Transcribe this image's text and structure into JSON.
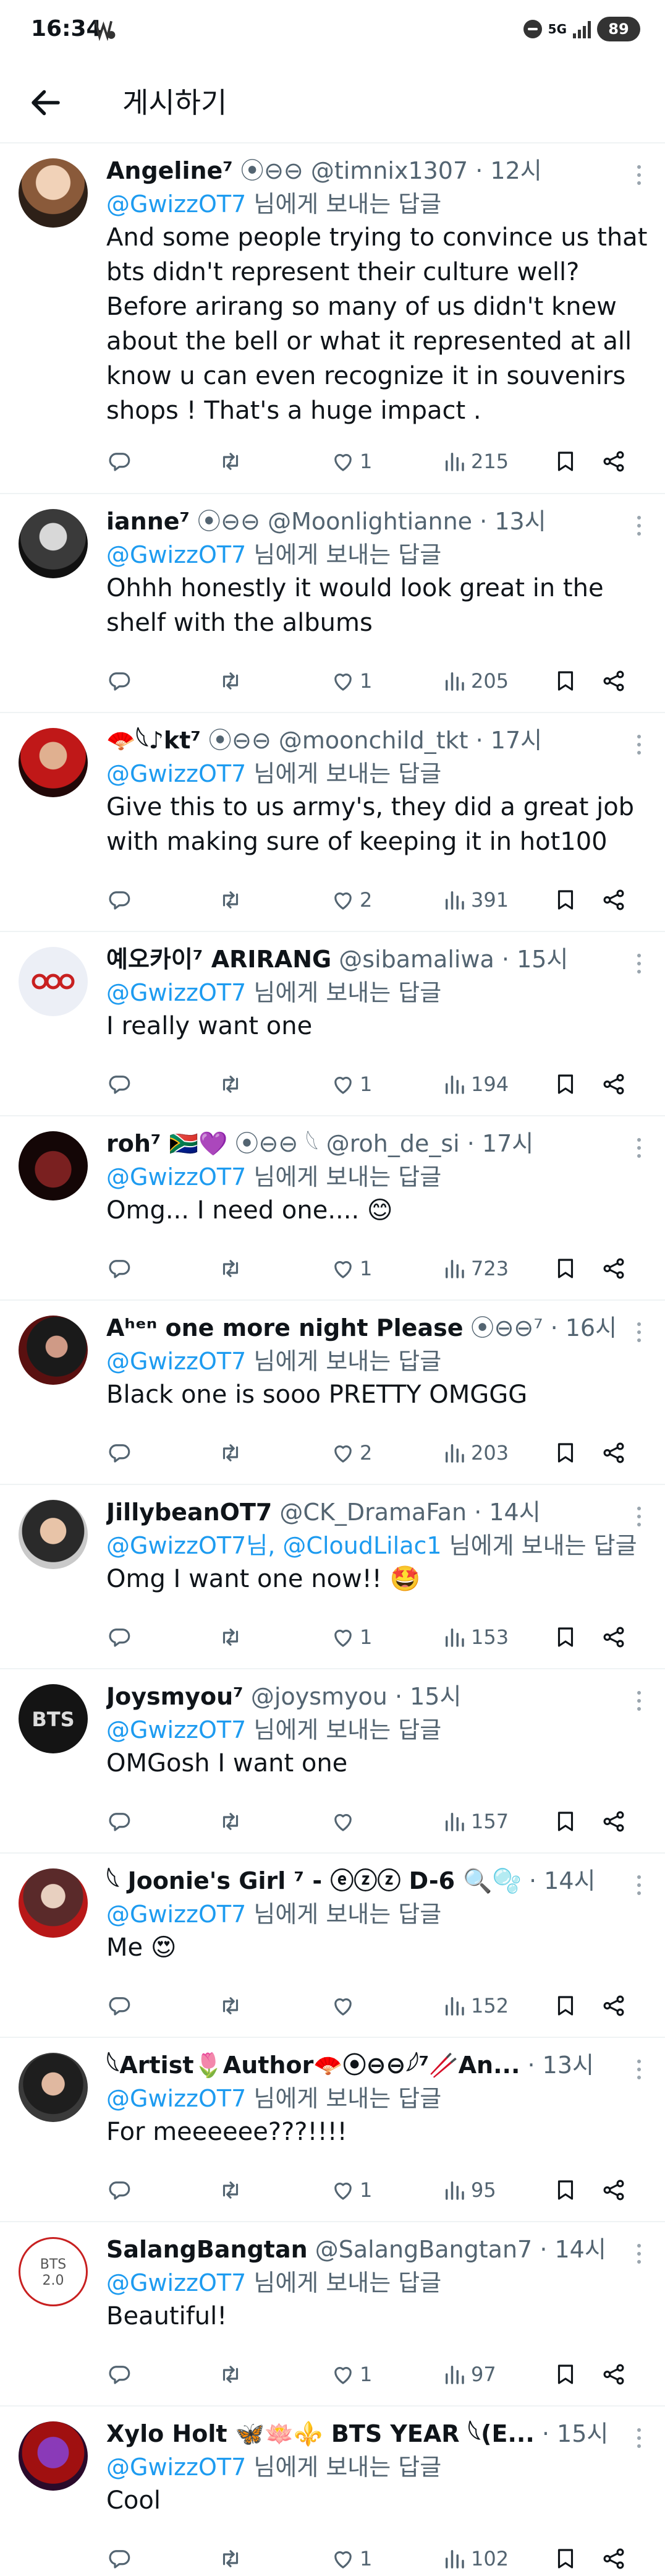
{
  "status_bar": {
    "time": "16:34",
    "network": "5G",
    "battery": "89"
  },
  "header": {
    "title": "게시하기"
  },
  "replying_suffix": "님에게 보내는 답글",
  "colors": {
    "link": "#1d9bf0",
    "secondary": "#536471",
    "divider": "#eff3f4"
  },
  "posts": [
    {
      "name": "Angeline⁷",
      "badges": "⦿⊖⊖",
      "handle": "@timnix1307",
      "time": "· 12시",
      "reply_to": "@GwizzOT7",
      "reply_to_2": "",
      "text": "And some people trying to convince us that bts didn't represent their culture well? Before arirang so many of us didn't knew about the bell or what it represented at all know u can even recognize it in souvenirs shops ! That's a huge impact  .",
      "likes": "1",
      "views": "215"
    },
    {
      "name": "ianne⁷",
      "badges": "⦿⊖⊖",
      "handle": "@Moonlightianne",
      "time": "· 13시",
      "reply_to": "@GwizzOT7",
      "reply_to_2": "",
      "text": "Ohhh honestly it would look great in the shelf with the albums",
      "likes": "1",
      "views": "205"
    },
    {
      "name": "🪭𓆩♪kt⁷",
      "badges": "⦿⊖⊖",
      "handle": "@moonchild_tkt",
      "time": "· 17시",
      "reply_to": "@GwizzOT7",
      "reply_to_2": "",
      "text": "Give this to us army's, they did a great job with making sure of keeping it in hot100",
      "likes": "2",
      "views": "391"
    },
    {
      "name": "예오카이⁷ ARIRANG",
      "badges": "",
      "handle": "@sibamaliwa",
      "time": "· 15시",
      "reply_to": "@GwizzOT7",
      "reply_to_2": "",
      "text": "I really want one",
      "likes": "1",
      "views": "194"
    },
    {
      "name": "roh⁷ 🇿🇦💜",
      "badges": "⦿⊖⊖ 𓆩",
      "handle": "@roh_de_si",
      "time": "· 17시",
      "reply_to": "@GwizzOT7",
      "reply_to_2": "",
      "text": "Omg... I need one.... 😊",
      "likes": "1",
      "views": "723"
    },
    {
      "name": "Aʰᵉⁿ one more night Please",
      "badges": "⦿⊖⊖⁷",
      "handle": "",
      "time": "· 16시",
      "reply_to": "@GwizzOT7",
      "reply_to_2": "",
      "text": "Black one is sooo PRETTY OMGGG",
      "likes": "2",
      "views": "203"
    },
    {
      "name": "JillybeanOT7",
      "badges": "",
      "handle": "@CK_DramaFan",
      "time": "· 14시",
      "reply_to": "@GwizzOT7",
      "reply_to_2": "@CloudLilac1",
      "text": "Omg I want one now!! 🤩",
      "likes": "1",
      "views": "153"
    },
    {
      "name": "Joysmyou⁷",
      "badges": "",
      "handle": "@joysmyou",
      "time": "· 15시",
      "reply_to": "@GwizzOT7",
      "reply_to_2": "",
      "text": "OMGosh I want one",
      "likes": "",
      "views": "157"
    },
    {
      "name": "𓆩 Joonie's Girl ⁷ - ⓔⓩⓩ D-6 🔍🫧",
      "badges": "",
      "handle": "",
      "time": "· 14시",
      "reply_to": "@GwizzOT7",
      "reply_to_2": "",
      "text": "Me 😍",
      "likes": "",
      "views": "152"
    },
    {
      "name": "𓆩Artist🌷Author🪭⦿⊖⊖𓆪⁷🥢An...",
      "badges": "",
      "handle": "",
      "time": "· 13시",
      "reply_to": "@GwizzOT7",
      "reply_to_2": "",
      "text": "For meeeeee???!!!!",
      "likes": "1",
      "views": "95"
    },
    {
      "name": "SalangBangtan",
      "badges": "",
      "handle": "@SalangBangtan7",
      "time": "· 14시",
      "reply_to": "@GwizzOT7",
      "reply_to_2": "",
      "text": "Beautiful!",
      "likes": "1",
      "views": "97"
    },
    {
      "name": "Xylo Holt 🦋🪷⚜️ BTS YEAR 𓆩(E...",
      "badges": "",
      "handle": "",
      "time": "· 15시",
      "reply_to": "@GwizzOT7",
      "reply_to_2": "",
      "text": "Cool",
      "likes": "1",
      "views": "102"
    }
  ]
}
